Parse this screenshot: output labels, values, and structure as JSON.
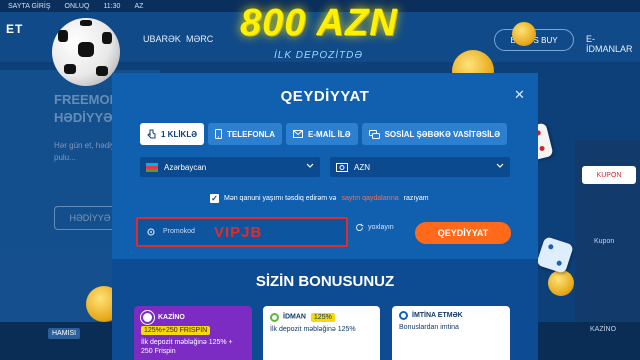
{
  "topbar": {
    "signin": "SAYTA GİRİŞ",
    "online": "ONLUQ",
    "time": "11:30",
    "lang": "AZ"
  },
  "header": {
    "logo_text": "ET",
    "nav": [
      "UBARƏK",
      "MƏRC"
    ],
    "bonus_buy": "BONUS BUY",
    "e_idman": "E-İDMANLAR"
  },
  "promo": {
    "title": "800 AZN",
    "subtitle": "İLK DEPOZİTDƏ"
  },
  "background": {
    "left_title_1": "FREEMONEY-DƏ",
    "left_title_2": "HƏDİYYƏ...",
    "left_text": "Hər gün et, hədiyy... İştirak et, pulu...",
    "left_button": "HƏDİYYƏ",
    "kupon": "KUPON",
    "kupon_sub": "Kupon",
    "hamisi": "HAMISI",
    "kazino_right": "KAZİNO"
  },
  "modal": {
    "title": "QEYDİYYAT",
    "close_icon": "close-icon",
    "tabs": [
      {
        "label": "1 KLİKLƏ",
        "icon": "pointer-icon"
      },
      {
        "label": "TELEFONLA",
        "icon": "phone-icon"
      },
      {
        "label": "E-MAİL İLƏ",
        "icon": "mail-icon"
      },
      {
        "label": "SOSİAL ŞƏBƏKƏ VASİTƏSİLƏ",
        "icon": "chat-icon"
      }
    ],
    "country": "Azərbaycan",
    "currency": "AZN",
    "agree_pre": "Mən qanuni yaşımı təsdiq edirəm və",
    "agree_link": "saytın qaydalarına",
    "agree_post": "razıyam",
    "promo_placeholder": "Promokod",
    "promo_code": "VIPJB",
    "verify": "yoxlayın",
    "register_button": "QEYDİYYAT"
  },
  "bonus": {
    "title": "SİZİN BONUSUNUZ",
    "cards": [
      {
        "name": "KAZİNO",
        "badge": "125%+250 FRİSPİN",
        "desc": "İlk depozit məbləğinə 125% + 250 Frispin"
      },
      {
        "name": "İDMAN",
        "badge": "125%",
        "desc": "İlk depozit məbləğinə 125%"
      },
      {
        "name": "İMTİNA ETMƏK",
        "badge": "",
        "desc": "Bonuslardan imtina"
      }
    ]
  },
  "colors": {
    "accent": "#ff6a1a",
    "highlight": "#e22b2b",
    "promo_yellow": "#fff200",
    "modal_blue": "#1160b0"
  }
}
